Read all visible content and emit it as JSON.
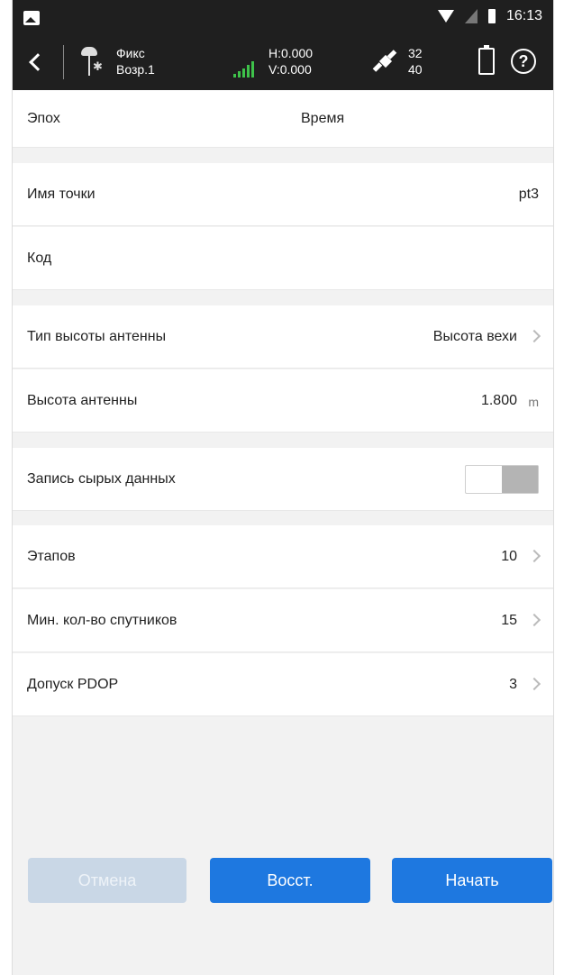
{
  "status_bar": {
    "time": "16:13"
  },
  "toolbar": {
    "fix_status": "Фикс",
    "age": "Возр.1",
    "h_value": "H:0.000",
    "v_value": "V:0.000",
    "sat_used": "32",
    "sat_visible": "40"
  },
  "epoch_header": {
    "epoch_label": "Эпох",
    "time_label": "Время"
  },
  "point": {
    "name_label": "Имя точки",
    "name_value": "pt3",
    "code_label": "Код",
    "code_value": ""
  },
  "antenna": {
    "type_label": "Тип высоты антенны",
    "type_value": "Высота вехи",
    "height_label": "Высота антенны",
    "height_value": "1.800",
    "height_unit": "m"
  },
  "raw": {
    "label": "Запись сырых данных",
    "enabled": false
  },
  "settings": {
    "stages_label": "Этапов",
    "stages_value": "10",
    "min_sats_label": "Мин. кол-во спутников",
    "min_sats_value": "15",
    "pdop_label": "Допуск PDOP",
    "pdop_value": "3"
  },
  "buttons": {
    "cancel": "Отмена",
    "restore": "Восст.",
    "start": "Начать"
  },
  "colors": {
    "primary": "#1e78e0",
    "disabled": "#c9d7e6",
    "signal": "#3ec24a",
    "header_bg": "#1f1f1f"
  }
}
